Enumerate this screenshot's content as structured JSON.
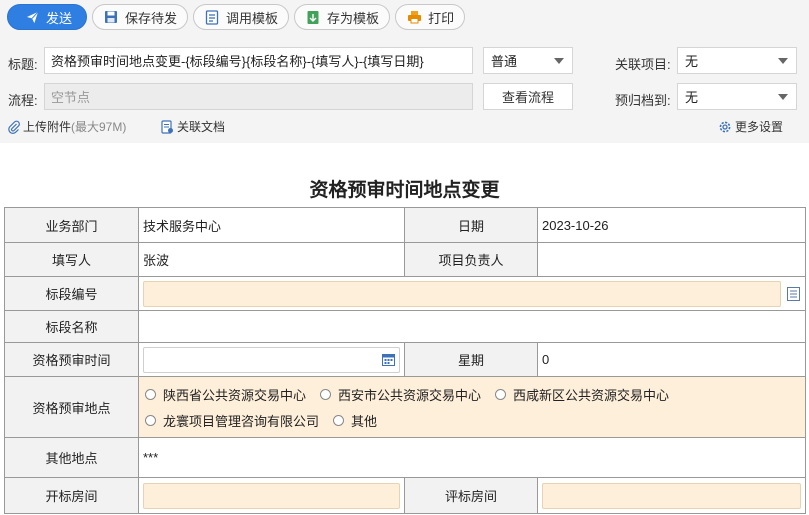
{
  "toolbar": {
    "send": "发送",
    "save_draft": "保存待发",
    "use_template": "调用模板",
    "save_template": "存为模板",
    "print": "打印"
  },
  "header": {
    "title_label": "标题:",
    "title_value": "资格预审时间地点变更-{标段编号}{标段名称}-{填写人}-{填写日期}",
    "priority_value": "普通",
    "related_project_label": "关联项目:",
    "related_project_value": "无",
    "flow_label": "流程:",
    "flow_placeholder": "空节点",
    "view_flow": "查看流程",
    "archive_label": "预归档到:",
    "archive_value": "无",
    "upload_label": "上传附件",
    "upload_limit": "(最大97M)",
    "related_docs": "关联文档",
    "more_settings": "更多设置"
  },
  "form": {
    "title": "资格预审时间地点变更",
    "dept_label": "业务部门",
    "dept_value": "技术服务中心",
    "date_label": "日期",
    "date_value": "2023-10-26",
    "filler_label": "填写人",
    "filler_value": "张波",
    "pm_label": "项目负责人",
    "pm_value": "",
    "section_no_label": "标段编号",
    "section_name_label": "标段名称",
    "prequal_time_label": "资格预审时间",
    "weekday_label": "星期",
    "weekday_value": "0",
    "prequal_place_label": "资格预审地点",
    "places": [
      "陕西省公共资源交易中心",
      "西安市公共资源交易中心",
      "西咸新区公共资源交易中心",
      "龙寰项目管理咨询有限公司",
      "其他"
    ],
    "other_place_label": "其他地点",
    "other_place_value": "***",
    "open_room_label": "开标房间",
    "eval_room_label": "评标房间"
  },
  "colors": {
    "primary": "#2f7fe3",
    "required_field": "#fdefd9"
  }
}
